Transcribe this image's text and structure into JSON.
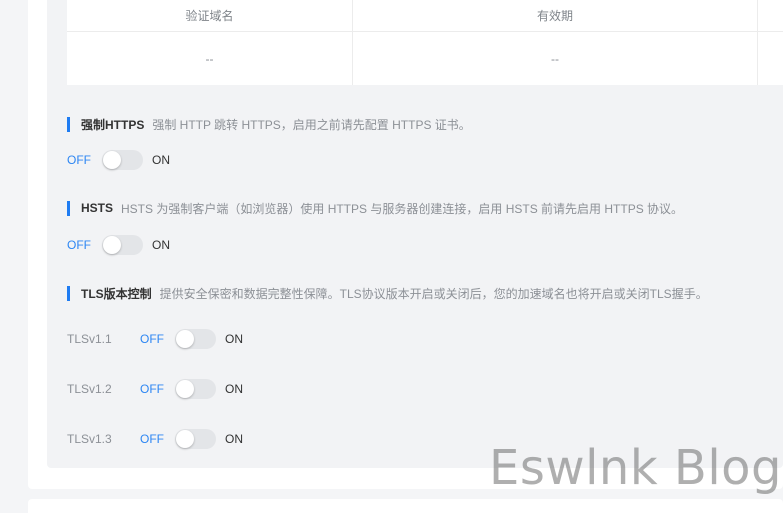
{
  "table": {
    "headers": [
      "验证域名",
      "有效期"
    ],
    "rows": [
      [
        "--",
        "--"
      ]
    ]
  },
  "force_https": {
    "title": "强制HTTPS",
    "description": "强制 HTTP 跳转 HTTPS，启用之前请先配置 HTTPS 证书。",
    "off_label": "OFF",
    "on_label": "ON",
    "state": "off"
  },
  "hsts": {
    "title": "HSTS",
    "description": "HSTS 为强制客户端（如浏览器）使用 HTTPS 与服务器创建连接，启用 HSTS 前请先启用 HTTPS 协议。",
    "off_label": "OFF",
    "on_label": "ON",
    "state": "off"
  },
  "tls": {
    "title": "TLS版本控制",
    "description": "提供安全保密和数据完整性保障。TLS协议版本开启或关闭后，您的加速域名也将开启或关闭TLS握手。",
    "versions": [
      {
        "label": "TLSv1.1",
        "off_label": "OFF",
        "on_label": "ON",
        "state": "off"
      },
      {
        "label": "TLSv1.2",
        "off_label": "OFF",
        "on_label": "ON",
        "state": "off"
      },
      {
        "label": "TLSv1.3",
        "off_label": "OFF",
        "on_label": "ON",
        "state": "off"
      }
    ]
  },
  "watermark": "Eswlnk Blog",
  "colors": {
    "accent": "#1f7cf2",
    "off_text": "#2d86f3",
    "toggle_track": "#e3e5e8"
  }
}
